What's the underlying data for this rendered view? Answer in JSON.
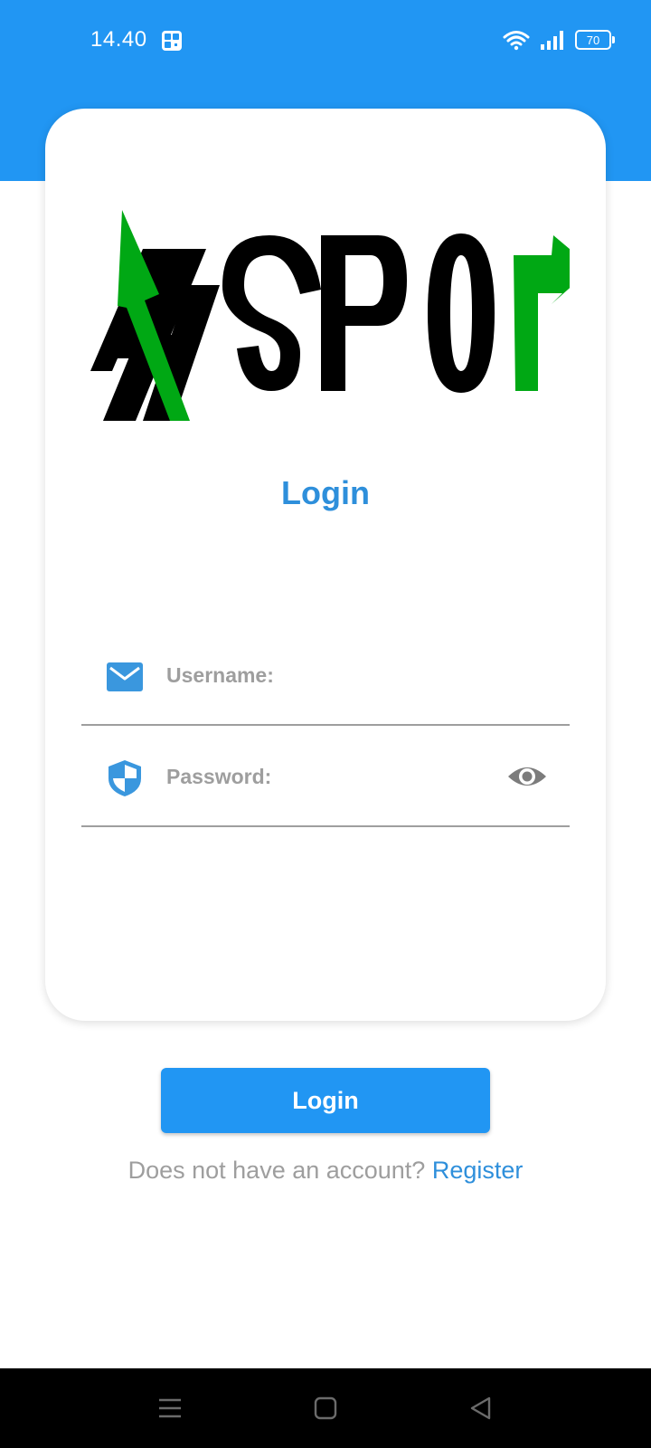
{
  "status_bar": {
    "time": "14.40",
    "battery": "70",
    "icons": [
      "app-notification-icon",
      "wifi-icon",
      "signal-icon",
      "battery-icon"
    ]
  },
  "logo": {
    "text": "DX SPOT",
    "colors": {
      "dark": "#000000",
      "accent": "#00A814"
    }
  },
  "login_form": {
    "title": "Login",
    "username": {
      "placeholder": "Username:",
      "value": "",
      "icon": "mail-icon"
    },
    "password": {
      "placeholder": "Password:",
      "value": "",
      "icon": "shield-icon",
      "toggle_icon": "eye-icon"
    },
    "submit_label": "Login"
  },
  "register": {
    "prompt": "Does not have an account?",
    "link_label": "Register"
  },
  "nav_bar": {
    "buttons": [
      "menu-icon",
      "home-icon",
      "back-icon"
    ]
  },
  "colors": {
    "primary": "#2196F3",
    "title_blue": "#2E8FDB",
    "muted_text": "#9e9e9e"
  }
}
